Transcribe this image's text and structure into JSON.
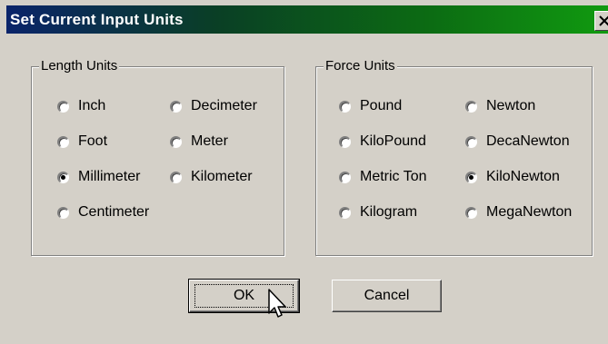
{
  "window": {
    "title": "Set Current Input Units",
    "close_glyph": "×"
  },
  "length_group": {
    "legend": "Length Units",
    "options": [
      {
        "label": "Inch",
        "selected": false
      },
      {
        "label": "Foot",
        "selected": false
      },
      {
        "label": "Millimeter",
        "selected": true
      },
      {
        "label": "Centimeter",
        "selected": false
      },
      {
        "label": "Decimeter",
        "selected": false
      },
      {
        "label": "Meter",
        "selected": false
      },
      {
        "label": "Kilometer",
        "selected": false
      }
    ]
  },
  "force_group": {
    "legend": "Force Units",
    "options": [
      {
        "label": "Pound",
        "selected": false
      },
      {
        "label": "KiloPound",
        "selected": false
      },
      {
        "label": "Metric Ton",
        "selected": false
      },
      {
        "label": "Kilogram",
        "selected": false
      },
      {
        "label": "Newton",
        "selected": false
      },
      {
        "label": "DecaNewton",
        "selected": false
      },
      {
        "label": "KiloNewton",
        "selected": true
      },
      {
        "label": "MegaNewton",
        "selected": false
      }
    ]
  },
  "buttons": {
    "ok_label": "OK",
    "cancel_label": "Cancel"
  },
  "colors": {
    "title_start": "#0a246a",
    "title_end": "#109a10",
    "face": "#d4d0c8"
  }
}
